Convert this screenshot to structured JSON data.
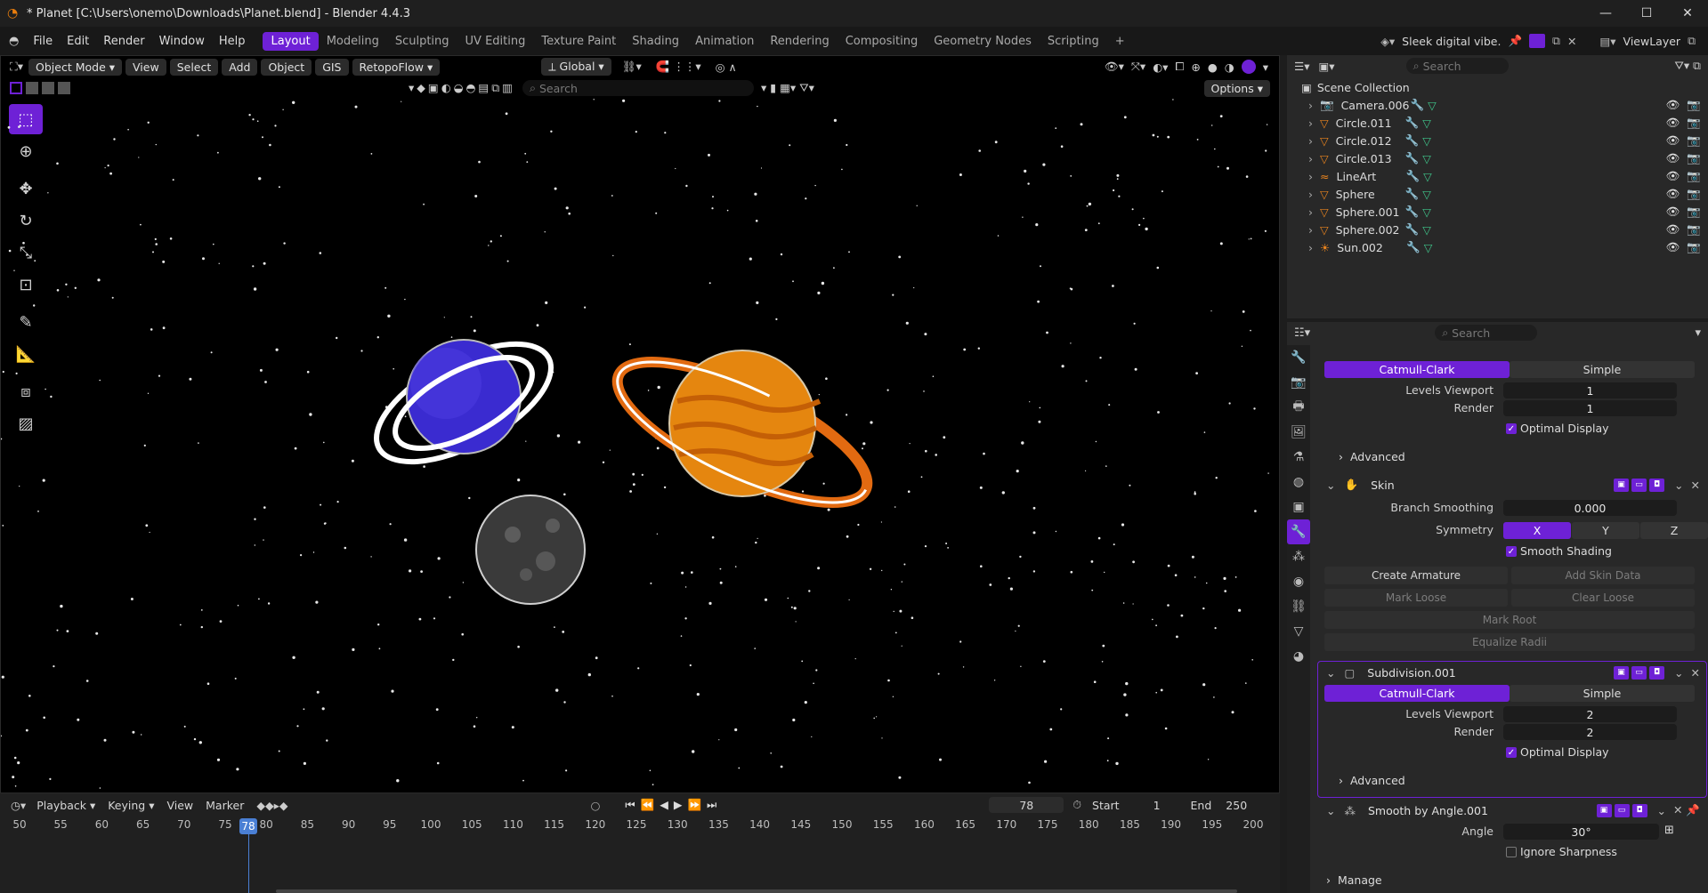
{
  "window": {
    "title": "* Planet [C:\\Users\\onemo\\Downloads\\Planet.blend] - Blender 4.4.3",
    "minimize": "—",
    "maximize": "☐",
    "close": "✕"
  },
  "menu": [
    "File",
    "Edit",
    "Render",
    "Window",
    "Help"
  ],
  "workspaces": [
    "Layout",
    "Modeling",
    "Sculpting",
    "UV Editing",
    "Texture Paint",
    "Shading",
    "Animation",
    "Rendering",
    "Compositing",
    "Geometry Nodes",
    "Scripting"
  ],
  "workspace_add": "+",
  "topright": {
    "style_preset": "Sleek digital vibe.",
    "view_layer": "ViewLayer"
  },
  "viewport": {
    "mode": "Object Mode",
    "menus": [
      "View",
      "Select",
      "Add",
      "Object",
      "GIS",
      "RetopoFlow"
    ],
    "orientation": "Global",
    "search_placeholder": "Search",
    "options": "Options"
  },
  "timeline": {
    "menus": [
      "Playback",
      "Keying",
      "View",
      "Marker"
    ],
    "current_frame": "78",
    "start_label": "Start",
    "start": "1",
    "end_label": "End",
    "end": "250",
    "ruler": [
      "50",
      "55",
      "60",
      "65",
      "70",
      "75",
      "80",
      "85",
      "90",
      "95",
      "100",
      "105",
      "110",
      "115",
      "120",
      "125",
      "130",
      "135",
      "140",
      "145",
      "150",
      "155",
      "160",
      "165",
      "170",
      "175",
      "180",
      "185",
      "190",
      "195",
      "200"
    ],
    "playhead": "78"
  },
  "outliner": {
    "search_placeholder": "Search",
    "root": "Scene Collection",
    "items": [
      {
        "name": "Camera.006",
        "icon": "camera-icon"
      },
      {
        "name": "Circle.011",
        "icon": "mesh-icon"
      },
      {
        "name": "Circle.012",
        "icon": "mesh-icon"
      },
      {
        "name": "Circle.013",
        "icon": "mesh-icon"
      },
      {
        "name": "LineArt",
        "icon": "lineart-icon"
      },
      {
        "name": "Sphere",
        "icon": "mesh-icon"
      },
      {
        "name": "Sphere.001",
        "icon": "mesh-icon"
      },
      {
        "name": "Sphere.002",
        "icon": "mesh-icon"
      },
      {
        "name": "Sun.002",
        "icon": "light-icon"
      }
    ]
  },
  "properties": {
    "search_placeholder": "Search",
    "subdiv1": {
      "method_a": "Catmull-Clark",
      "method_b": "Simple",
      "levels_label": "Levels Viewport",
      "levels": "1",
      "render_label": "Render",
      "render": "1",
      "optimal": "Optimal Display",
      "advanced": "Advanced"
    },
    "skin": {
      "name": "Skin",
      "branch_label": "Branch Smoothing",
      "branch": "0.000",
      "sym_label": "Symmetry",
      "x": "X",
      "y": "Y",
      "z": "Z",
      "smooth": "Smooth Shading",
      "create_armature": "Create Armature",
      "add_skin_data": "Add Skin Data",
      "mark_loose": "Mark Loose",
      "clear_loose": "Clear Loose",
      "mark_root": "Mark Root",
      "equalize": "Equalize Radii"
    },
    "subdiv2": {
      "name": "Subdivision.001",
      "method_a": "Catmull-Clark",
      "method_b": "Simple",
      "levels_label": "Levels Viewport",
      "levels": "2",
      "render_label": "Render",
      "render": "2",
      "optimal": "Optimal Display",
      "advanced": "Advanced"
    },
    "smooth_angle": {
      "name": "Smooth by Angle.001",
      "angle_label": "Angle",
      "angle": "30°",
      "ignore": "Ignore Sharpness",
      "manage": "Manage"
    }
  },
  "colors": {
    "accent": "#6e21d6",
    "viewport_bg": "#000000",
    "panel_bg": "#282828"
  }
}
